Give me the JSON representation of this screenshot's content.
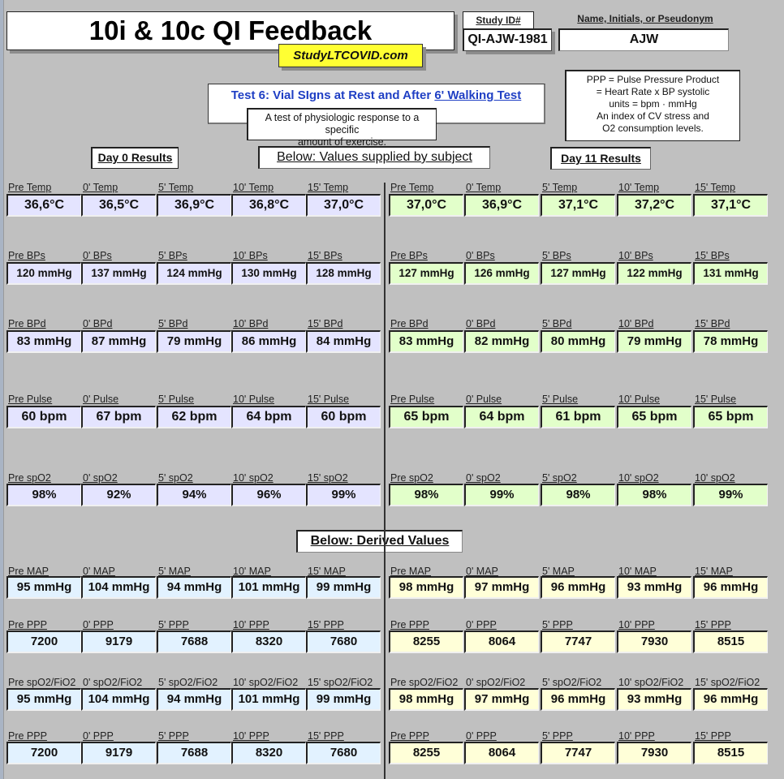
{
  "header": {
    "title": "10i & 10c QI Feedback",
    "site": "StudyLTCOVID.com",
    "study_id_label": "Study ID#",
    "study_id_value": "QI-AJW-1981",
    "name_label": "Name, Initials, or Pseudonym",
    "name_value": "AJW"
  },
  "test": {
    "title_prefix": "Test 6: Vial SIgns at Rest and After ",
    "title_link": "6' Walking Test",
    "description_line1": "A test of physiologic response to a specific",
    "description_line2": "amount of exercise."
  },
  "ppp_note": {
    "lines": [
      "PPP = Pulse Pressure Product",
      "= Heart Rate x BP systolic",
      "units = bpm · mmHg",
      "An index of CV stress and",
      "O2 consumption levels."
    ]
  },
  "sections": {
    "day0_label": "Day 0 Results",
    "day11_label": "Day 11 Results",
    "supplied_label": "Below: Values supplied by subject",
    "derived_label": "Below: Derived Values"
  },
  "rows": [
    {
      "key": "temp",
      "day0_labels": [
        "Pre Temp",
        " 0' Temp",
        " 5' Temp",
        " 10' Temp",
        " 15' Temp"
      ],
      "day0_values": [
        "36,6°C",
        "36,5°C",
        "36,9°C",
        "36,8°C",
        "37,0°C"
      ],
      "day11_labels": [
        "Pre Temp",
        " 0' Temp",
        " 5' Temp",
        " 10' Temp",
        " 15' Temp"
      ],
      "day11_values": [
        "37,0°C",
        "36,9°C",
        "37,1°C",
        "37,2°C",
        "37,1°C"
      ]
    },
    {
      "key": "bps",
      "day0_labels": [
        "Pre BPs",
        " 0' BPs",
        " 5' BPs",
        " 10' BPs",
        " 15' BPs"
      ],
      "day0_values": [
        "120 mmHg",
        "137 mmHg",
        "124 mmHg",
        "130 mmHg",
        "128 mmHg"
      ],
      "day11_labels": [
        "Pre BPs",
        " 0' BPs",
        " 5' BPs",
        " 10' BPs",
        " 15' BPs"
      ],
      "day11_values": [
        "127 mmHg",
        "126 mmHg",
        "127 mmHg",
        "122 mmHg",
        "131 mmHg"
      ]
    },
    {
      "key": "bpd",
      "day0_labels": [
        "Pre BPd",
        " 0' BPd",
        " 5' BPd",
        " 10' BPd",
        " 15' BPd"
      ],
      "day0_values": [
        "83 mmHg",
        "87 mmHg",
        "79 mmHg",
        "86 mmHg",
        "84 mmHg"
      ],
      "day11_labels": [
        "Pre BPd",
        " 0' BPd",
        " 5' BPd",
        " 10' BPd",
        " 15' BPd"
      ],
      "day11_values": [
        "83 mmHg",
        "82 mmHg",
        "80 mmHg",
        "79 mmHg",
        "78 mmHg"
      ]
    },
    {
      "key": "pulse",
      "day0_labels": [
        "Pre Pulse",
        " 0' Pulse",
        " 5' Pulse",
        " 10' Pulse",
        " 15' Pulse"
      ],
      "day0_values": [
        "60 bpm",
        "67 bpm",
        "62 bpm",
        "64 bpm",
        "60 bpm"
      ],
      "day11_labels": [
        "Pre Pulse",
        " 0' Pulse",
        " 5' Pulse",
        " 10' Pulse",
        " 15' Pulse"
      ],
      "day11_values": [
        "65 bpm",
        "64 bpm",
        "61 bpm",
        "65 bpm",
        "65 bpm"
      ]
    },
    {
      "key": "spo2",
      "day0_labels": [
        "Pre spO2",
        " 0' spO2",
        " 5' spO2",
        " 10' spO2",
        " 15' spO2"
      ],
      "day0_values": [
        "98%",
        "92%",
        "94%",
        "96%",
        "99%"
      ],
      "day11_labels": [
        "Pre spO2",
        " 0' spO2",
        " 5' spO2",
        " 10' spO2",
        " 10' spO2"
      ],
      "day11_values": [
        "98%",
        "99%",
        "98%",
        "98%",
        "99%"
      ]
    },
    {
      "key": "map",
      "day0_labels": [
        "Pre MAP",
        " 0' MAP",
        " 5' MAP",
        " 10' MAP",
        " 15' MAP"
      ],
      "day0_values": [
        "95 mmHg",
        "104 mmHg",
        "94 mmHg",
        "101 mmHg",
        "99 mmHg"
      ],
      "day11_labels": [
        "Pre MAP",
        " 0' MAP",
        " 5' MAP",
        " 10' MAP",
        " 15' MAP"
      ],
      "day11_values": [
        "98 mmHg",
        "97 mmHg",
        "96 mmHg",
        "93 mmHg",
        "96 mmHg"
      ]
    },
    {
      "key": "ppp",
      "day0_labels": [
        "Pre PPP",
        " 0' PPP",
        " 5' PPP",
        " 10' PPP",
        " 15' PPP"
      ],
      "day0_values": [
        "7200",
        "9179",
        "7688",
        "8320",
        "7680"
      ],
      "day11_labels": [
        "Pre PPP",
        " 0' PPP",
        " 5' PPP",
        " 10' PPP",
        " 15' PPP"
      ],
      "day11_values": [
        "8255",
        "8064",
        "7747",
        "7930",
        "8515"
      ]
    },
    {
      "key": "spo2fio2",
      "day0_labels": [
        "Pre spO2/FiO2",
        "0' spO2/FiO2",
        "5' spO2/FiO2",
        "10' spO2/FiO2",
        "15' spO2/FiO2"
      ],
      "day0_values": [
        "95 mmHg",
        "104 mmHg",
        "94 mmHg",
        "101 mmHg",
        "99 mmHg"
      ],
      "day11_labels": [
        "Pre spO2/FiO2",
        "0' spO2/FiO2",
        "5' spO2/FiO2",
        "10' spO2/FiO2",
        "15' spO2/FiO2"
      ],
      "day11_values": [
        "98 mmHg",
        "97 mmHg",
        "96 mmHg",
        "93 mmHg",
        "96 mmHg"
      ]
    },
    {
      "key": "ppp2",
      "day0_labels": [
        "Pre PPP",
        " 0' PPP",
        " 5' PPP",
        " 10' PPP",
        " 15' PPP"
      ],
      "day0_values": [
        "7200",
        "9179",
        "7688",
        "8320",
        "7680"
      ],
      "day11_labels": [
        "Pre PPP",
        " 0' PPP",
        " 5' PPP",
        " 10' PPP",
        " 15' PPP"
      ],
      "day11_values": [
        "8255",
        "8064",
        "7747",
        "7930",
        "8515"
      ]
    }
  ]
}
